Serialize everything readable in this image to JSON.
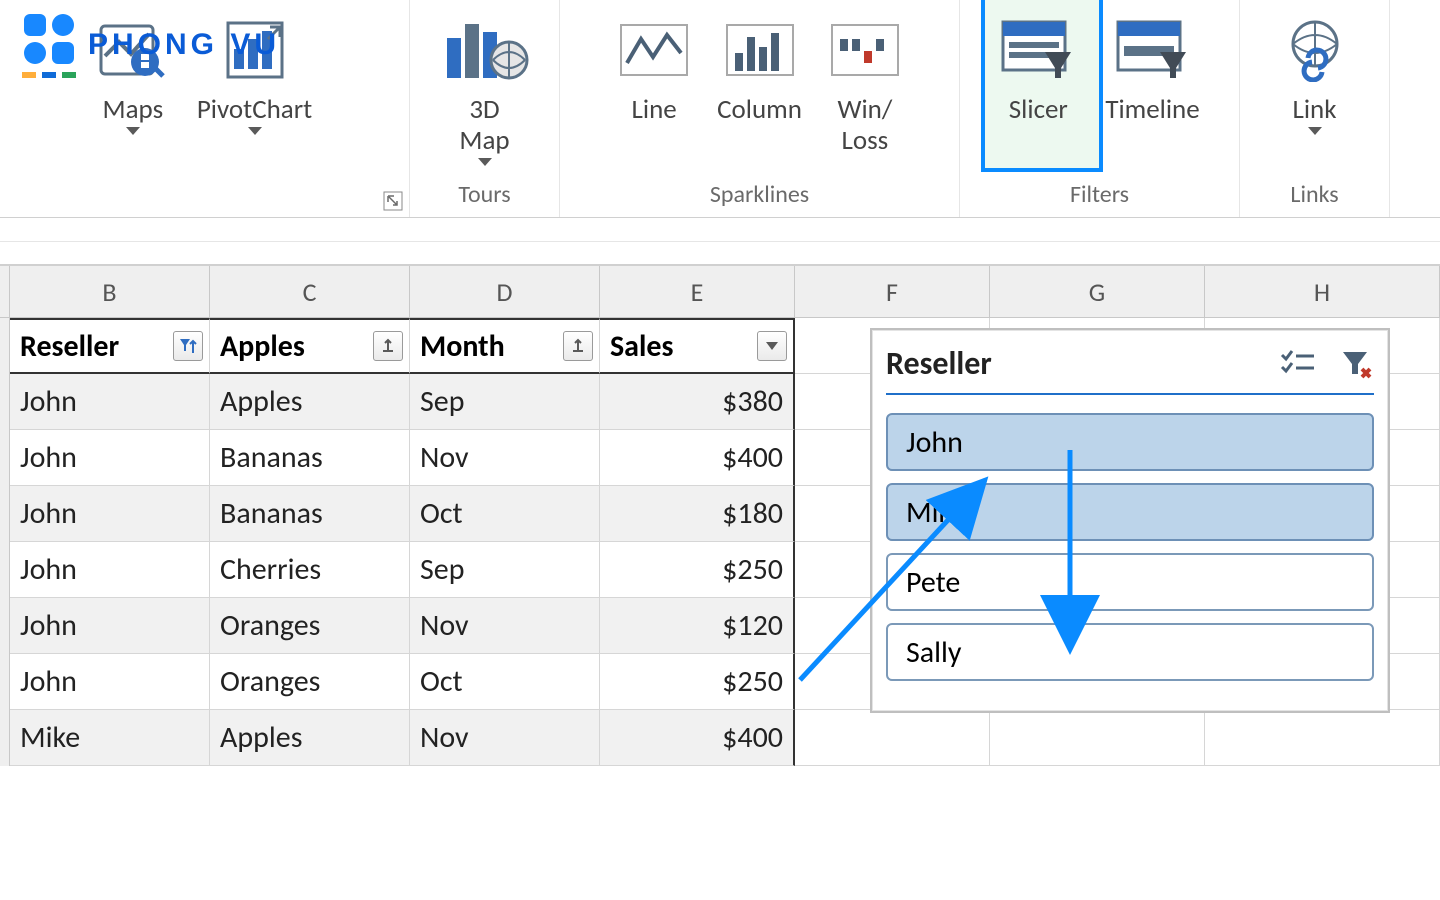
{
  "watermark": {
    "text": "PHONG VU"
  },
  "ribbon": {
    "charts_group": {
      "maps": "Maps",
      "pivotchart": "PivotChart"
    },
    "tours_group": {
      "label_group": "Tours",
      "map3d": "3D\nMap"
    },
    "sparklines_group": {
      "label_group": "Sparklines",
      "line": "Line",
      "column": "Column",
      "winloss": "Win/\nLoss"
    },
    "filters_group": {
      "label_group": "Filters",
      "slicer": "Slicer",
      "timeline": "Timeline"
    },
    "links_group": {
      "label_group": "Links",
      "link": "Link"
    }
  },
  "columns": {
    "B": "B",
    "C": "C",
    "D": "D",
    "E": "E",
    "F": "F",
    "G": "G",
    "H": "H"
  },
  "table": {
    "headers": {
      "reseller": "Reseller",
      "apples": "Apples",
      "month": "Month",
      "sales": "Sales"
    },
    "rows": [
      {
        "reseller": "John",
        "product": "Apples",
        "month": "Sep",
        "sales": "$380"
      },
      {
        "reseller": "John",
        "product": "Bananas",
        "month": "Nov",
        "sales": "$400"
      },
      {
        "reseller": "John",
        "product": "Bananas",
        "month": "Oct",
        "sales": "$180"
      },
      {
        "reseller": "John",
        "product": "Cherries",
        "month": "Sep",
        "sales": "$250"
      },
      {
        "reseller": "John",
        "product": "Oranges",
        "month": "Nov",
        "sales": "$120"
      },
      {
        "reseller": "John",
        "product": "Oranges",
        "month": "Oct",
        "sales": "$250"
      },
      {
        "reseller": "Mike",
        "product": "Apples",
        "month": "Nov",
        "sales": "$400"
      }
    ]
  },
  "slicer": {
    "title": "Reseller",
    "items": [
      {
        "label": "John",
        "selected": true
      },
      {
        "label": "Mike",
        "selected": true
      },
      {
        "label": "Pete",
        "selected": false
      },
      {
        "label": "Sally",
        "selected": false
      }
    ]
  }
}
